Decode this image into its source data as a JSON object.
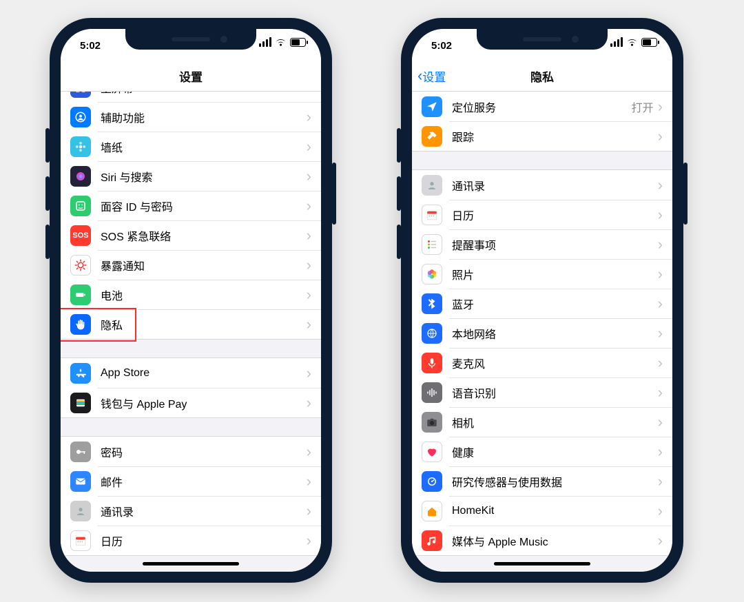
{
  "status_time": "5:02",
  "screen_settings": {
    "nav_title": "设置",
    "groups": [
      [
        {
          "id": "home-screen",
          "label": "主屏幕",
          "color": "#2f5bd7",
          "icon": "grid"
        },
        {
          "id": "accessibility",
          "label": "辅助功能",
          "color": "#007aff",
          "icon": "person"
        },
        {
          "id": "wallpaper",
          "label": "墙纸",
          "color": "#36c2e6",
          "icon": "flower"
        },
        {
          "id": "siri",
          "label": "Siri 与搜索",
          "color": "#22223a",
          "icon": "siri"
        },
        {
          "id": "faceid",
          "label": "面容 ID 与密码",
          "color": "#2ecc71",
          "icon": "face"
        },
        {
          "id": "sos",
          "label": "SOS 紧急联络",
          "color": "#ff3b30",
          "icon": "sos"
        },
        {
          "id": "exposure",
          "label": "暴露通知",
          "color": "#ffffff",
          "icon": "covid",
          "fg": "#ff2a2a",
          "stroke": true
        },
        {
          "id": "battery",
          "label": "电池",
          "color": "#2ecc71",
          "icon": "battery"
        },
        {
          "id": "privacy",
          "label": "隐私",
          "color": "#0a67ff",
          "icon": "hand",
          "highlighted": true
        }
      ],
      [
        {
          "id": "appstore",
          "label": "App Store",
          "color": "#1e90ff",
          "icon": "appstore"
        },
        {
          "id": "wallet",
          "label": "钱包与 Apple Pay",
          "color": "#1c1c1e",
          "icon": "wallet"
        }
      ],
      [
        {
          "id": "passwords",
          "label": "密码",
          "color": "#9e9e9e",
          "icon": "key"
        },
        {
          "id": "mail",
          "label": "邮件",
          "color": "#2e86ff",
          "icon": "mail"
        },
        {
          "id": "contacts",
          "label": "通讯录",
          "color": "#cfcfcf",
          "icon": "contacts"
        },
        {
          "id": "calendar",
          "label": "日历",
          "color": "#ffffff",
          "icon": "calendar",
          "stroke": true
        }
      ]
    ]
  },
  "screen_privacy": {
    "back_label": "设置",
    "nav_title": "隐私",
    "value_open": "打开",
    "groups": [
      [
        {
          "id": "location",
          "label": "定位服务",
          "color": "#1e90ff",
          "icon": "location",
          "value_ref": "value_open"
        },
        {
          "id": "tracking",
          "label": "跟踪",
          "color": "#ff9500",
          "icon": "tracking"
        }
      ],
      [
        {
          "id": "p-contacts",
          "label": "通讯录",
          "color": "#d7d7db",
          "icon": "contacts"
        },
        {
          "id": "p-calendar",
          "label": "日历",
          "color": "#ffffff",
          "icon": "calendar",
          "stroke": true
        },
        {
          "id": "p-reminders",
          "label": "提醒事项",
          "color": "#ffffff",
          "icon": "reminders",
          "stroke": true
        },
        {
          "id": "p-photos",
          "label": "照片",
          "color": "#ffffff",
          "icon": "photos",
          "stroke": true,
          "highlighted": true
        },
        {
          "id": "p-bluetooth",
          "label": "蓝牙",
          "color": "#1e6bff",
          "icon": "bluetooth",
          "highlighted": true
        },
        {
          "id": "p-localnet",
          "label": "本地网络",
          "color": "#1e6bff",
          "icon": "globe",
          "highlighted": true
        },
        {
          "id": "p-mic",
          "label": "麦克风",
          "color": "#ff3b30",
          "icon": "mic",
          "highlighted": true
        },
        {
          "id": "p-speech",
          "label": "语音识别",
          "color": "#6e6e73",
          "icon": "wave",
          "highlighted": true
        },
        {
          "id": "p-camera",
          "label": "相机",
          "color": "#8e8e93",
          "icon": "camera",
          "highlighted": true
        },
        {
          "id": "p-health",
          "label": "健康",
          "color": "#ffffff",
          "icon": "heart",
          "fg": "#ff2d55",
          "stroke": true
        },
        {
          "id": "p-research",
          "label": "研究传感器与使用数据",
          "color": "#1e6bff",
          "icon": "research"
        },
        {
          "id": "p-homekit",
          "label": "HomeKit",
          "color": "#ffffff",
          "icon": "home",
          "fg": "#ff9500",
          "stroke": true
        },
        {
          "id": "p-media",
          "label": "媒体与 Apple Music",
          "color": "#ff3b30",
          "icon": "music"
        }
      ]
    ]
  }
}
